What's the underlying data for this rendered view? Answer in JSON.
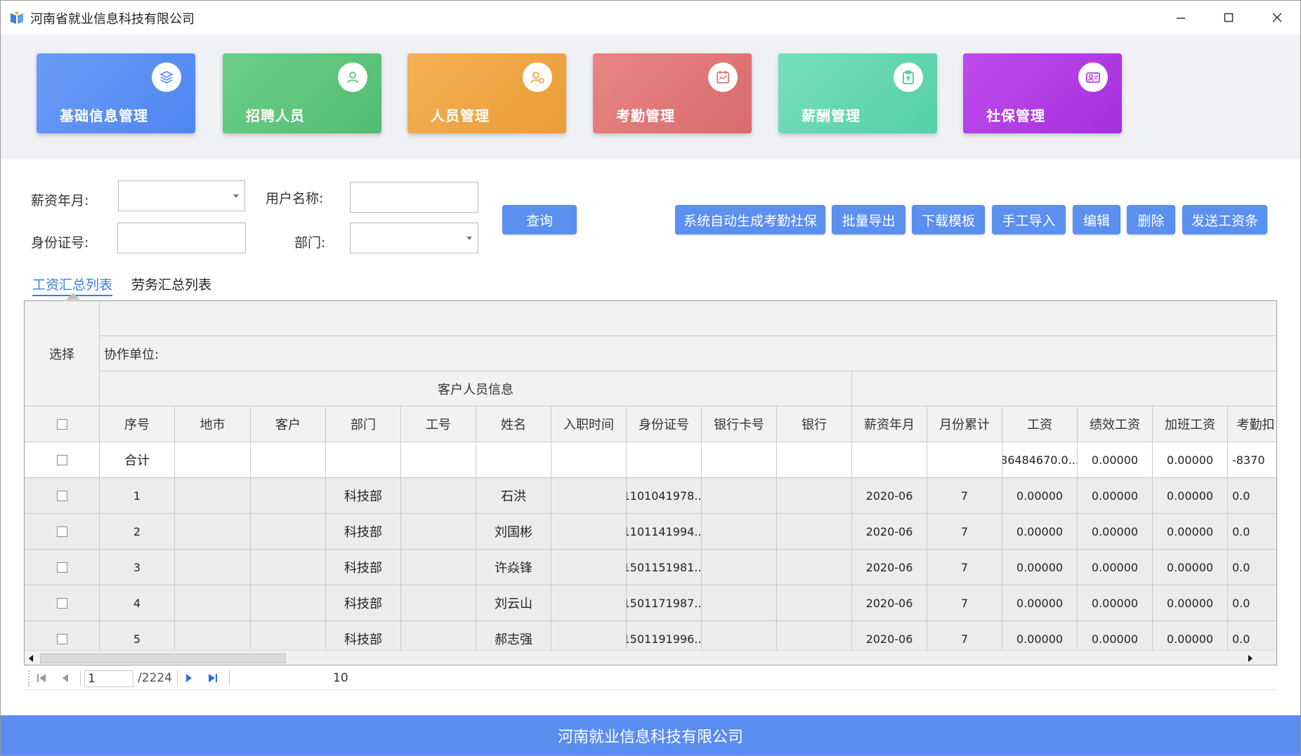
{
  "window": {
    "title": "河南省就业信息科技有限公司"
  },
  "modules": [
    {
      "label": "基础信息管理",
      "icon": "layers-icon",
      "color": "#5b8ff5"
    },
    {
      "label": "招聘人员",
      "icon": "person-icon",
      "color": "#5cc47a"
    },
    {
      "label": "人员管理",
      "icon": "person-settings-icon",
      "color": "#f0a340"
    },
    {
      "label": "考勤管理",
      "icon": "calendar-chart-icon",
      "color": "#e07676"
    },
    {
      "label": "薪酬管理",
      "icon": "clipboard-icon",
      "color": "#5ed6ad"
    },
    {
      "label": "社保管理",
      "icon": "id-card-icon",
      "color": "#b23be6"
    }
  ],
  "filters": {
    "salary_month_label": "薪资年月:",
    "salary_month_value": "",
    "username_label": "用户名称:",
    "username_value": "",
    "id_card_label": "身份证号:",
    "id_card_value": "",
    "department_label": "部门:",
    "department_value": ""
  },
  "buttons": {
    "query": "查询",
    "auto_generate": "系统自动生成考勤社保",
    "batch_export": "批量导出",
    "download_template": "下载模板",
    "manual_import": "手工导入",
    "edit": "编辑",
    "delete": "删除",
    "send_payslip": "发送工资条"
  },
  "tabs": [
    {
      "label": "工资汇总列表",
      "active": true
    },
    {
      "label": "劳务汇总列表",
      "active": false
    }
  ],
  "grid": {
    "select_header": "选择",
    "partner_unit_label": "协作单位:",
    "customer_group_header": "客户人员信息",
    "columns": [
      "序号",
      "地市",
      "客户",
      "部门",
      "工号",
      "姓名",
      "入职时间",
      "身份证号",
      "银行卡号",
      "银行",
      "薪资年月",
      "月份累计",
      "工资",
      "绩效工资",
      "加班工资",
      "考勤扣"
    ],
    "total_row": {
      "label": "合计",
      "salary": "86484670.0...",
      "performance": "0.00000",
      "overtime": "0.00000",
      "attendance": "-8370"
    },
    "rows": [
      {
        "seq": "1",
        "dept": "科技部",
        "name": "石洪",
        "id_card": "1101041978...",
        "month": "2020-06",
        "cumulative": "7",
        "salary": "0.00000",
        "performance": "0.00000",
        "overtime": "0.00000",
        "attendance": "0.0"
      },
      {
        "seq": "2",
        "dept": "科技部",
        "name": "刘国彬",
        "id_card": "1101141994...",
        "month": "2020-06",
        "cumulative": "7",
        "salary": "0.00000",
        "performance": "0.00000",
        "overtime": "0.00000",
        "attendance": "0.0"
      },
      {
        "seq": "3",
        "dept": "科技部",
        "name": "许焱锋",
        "id_card": "1501151981...",
        "month": "2020-06",
        "cumulative": "7",
        "salary": "0.00000",
        "performance": "0.00000",
        "overtime": "0.00000",
        "attendance": "0.0"
      },
      {
        "seq": "4",
        "dept": "科技部",
        "name": "刘云山",
        "id_card": "1501171987...",
        "month": "2020-06",
        "cumulative": "7",
        "salary": "0.00000",
        "performance": "0.00000",
        "overtime": "0.00000",
        "attendance": "0.0"
      },
      {
        "seq": "5",
        "dept": "科技部",
        "name": "郝志强",
        "id_card": "1501191996...",
        "month": "2020-06",
        "cumulative": "7",
        "salary": "0.00000",
        "performance": "0.00000",
        "overtime": "0.00000",
        "attendance": "0.0"
      }
    ]
  },
  "pager": {
    "current_page": "1",
    "total_pages": "/2224",
    "page_size": "10"
  },
  "footer": {
    "text": "河南就业信息科技有限公司"
  }
}
